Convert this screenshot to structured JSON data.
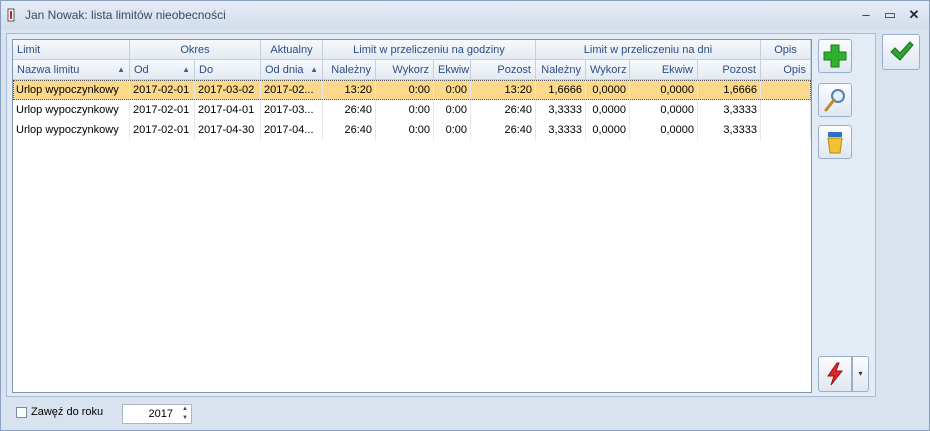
{
  "window": {
    "title": "Jan Nowak: lista limitów nieobecności"
  },
  "titlebar_buttons": {
    "minimize": "–",
    "maximize": "▭",
    "close": "✕"
  },
  "grid": {
    "group_headers": [
      "Limit",
      "Okres",
      "Aktualny",
      "Limit w przeliczeniu na godziny",
      "Limit w przeliczeniu na dni",
      "Opis"
    ],
    "columns": [
      "Nazwa limitu",
      "Od",
      "Do",
      "Od dnia",
      "Należny",
      "Wykorz",
      "Ekwiw",
      "Pozost",
      "Należny",
      "Wykorz",
      "Ekwiw",
      "Pozost",
      "Opis"
    ],
    "sort_indicator": "▲",
    "rows": [
      {
        "cells": [
          "Urlop wypoczynkowy",
          "2017-02-01",
          "2017-03-02",
          "2017-02...",
          "13:20",
          "0:00",
          "0:00",
          "13:20",
          "1,6666",
          "0,0000",
          "0,0000",
          "1,6666",
          ""
        ]
      },
      {
        "cells": [
          "Urlop wypoczynkowy",
          "2017-02-01",
          "2017-04-01",
          "2017-03...",
          "26:40",
          "0:00",
          "0:00",
          "26:40",
          "3,3333",
          "0,0000",
          "0,0000",
          "3,3333",
          ""
        ]
      },
      {
        "cells": [
          "Urlop wypoczynkowy",
          "2017-02-01",
          "2017-04-30",
          "2017-04...",
          "26:40",
          "0:00",
          "0:00",
          "26:40",
          "3,3333",
          "0,0000",
          "0,0000",
          "3,3333",
          ""
        ]
      }
    ]
  },
  "actions": {
    "add_icon": "plus-icon",
    "edit_icon": "magnifier-icon",
    "delete_icon": "trash-icon",
    "ok_icon": "checkmark-icon",
    "operations_icon": "lightning-icon",
    "dropdown_arrow": "▾"
  },
  "footer": {
    "filter_year_label": "Zawęź do roku",
    "year_value": "2017",
    "spin_up": "▲",
    "spin_down": "▼"
  },
  "colors": {
    "selected_row": "#fcd98a",
    "header_text": "#2b4e87"
  }
}
